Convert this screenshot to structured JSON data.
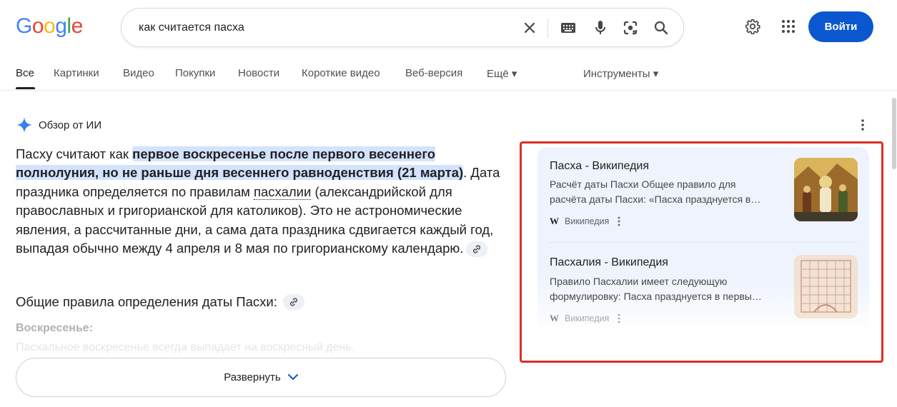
{
  "logo": {
    "letters": [
      "G",
      "o",
      "o",
      "g",
      "l",
      "e"
    ],
    "colors": [
      "#4285f4",
      "#ea4335",
      "#fbbc05",
      "#4285f4",
      "#34a853",
      "#ea4335"
    ]
  },
  "search": {
    "query": "как считается пасха"
  },
  "header": {
    "login_label": "Войти",
    "accent": "#0b57d0"
  },
  "tabs": [
    {
      "label": "Все"
    },
    {
      "label": "Картинки"
    },
    {
      "label": "Видео"
    },
    {
      "label": "Покупки"
    },
    {
      "label": "Новости"
    },
    {
      "label": "Короткие видео"
    },
    {
      "label": "Веб-версия"
    },
    {
      "label": "Ещё ▾"
    },
    {
      "label": "Инструменты ▾"
    }
  ],
  "ai_overview": {
    "label": "Обзор от ИИ",
    "p1_intro": "Пасху считают как ",
    "p1_highlight": "первое воскресенье после первого весеннего полнолуния, но не раньше дня весеннего равноденствия (21 марта)",
    "p1_after": ". Дата праздника определяется по правилам ",
    "p1_term": "пасхалии",
    "p1_rest": " (александрийской для православных и григорианской для католиков). Это не астрономические явления, а рассчитанные дни, а сама дата праздника сдвигается каждый год, выпадая обычно между 4 апреля и 8 мая по григорианскому календарю.",
    "subheading": "Общие правила определения даты Пасхи:",
    "faded_heading": "Воскресенье:",
    "faded_line": "Пасхальное воскресенье всегда выпадает на воскресный день.",
    "expand_label": "Развернуть"
  },
  "sources": [
    {
      "title": "Пасха - Википедия",
      "snippet_line1": "Расчёт даты Пасхи Общее правило для",
      "snippet_line2": "расчёта даты Пасхи: «Пасха празднуется в…",
      "site": "Википедия",
      "w": "W"
    },
    {
      "title": "Пасхалия - Википедия",
      "snippet_line1": "Правило Пасхалии имеет следующую",
      "snippet_line2": "формулировку: Пасха празднуется в первы…",
      "site": "Википедия",
      "w": "W"
    }
  ],
  "colors": {
    "highlight": "#d3e3fd",
    "annotation": "#d93025",
    "panel": "#eef3fd"
  }
}
